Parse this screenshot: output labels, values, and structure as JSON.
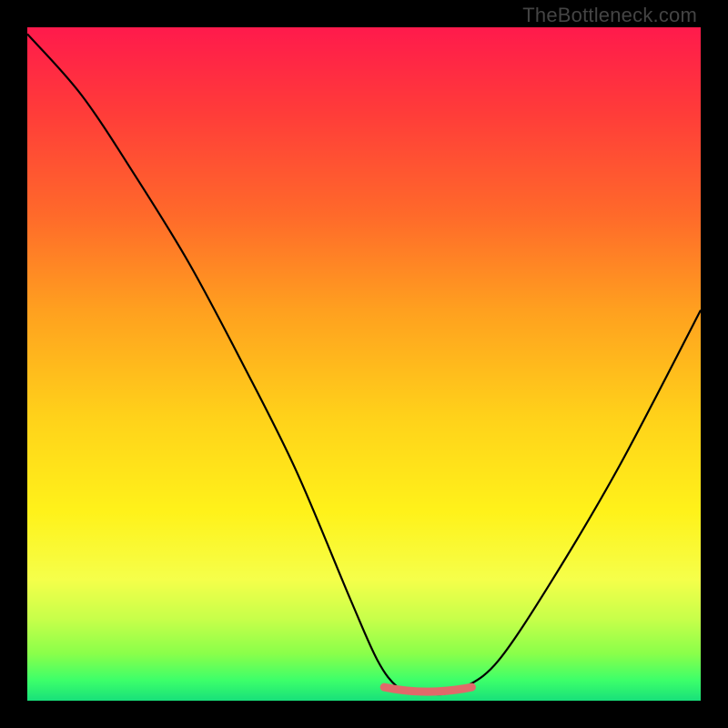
{
  "watermark": "TheBottleneck.com",
  "chart_data": {
    "type": "line",
    "title": "",
    "xlabel": "",
    "ylabel": "",
    "xlim": [
      0,
      100
    ],
    "ylim": [
      0,
      100
    ],
    "series": [
      {
        "name": "curve",
        "x": [
          0,
          8,
          16,
          24,
          32,
          40,
          48,
          52,
          55,
          58,
          60,
          62,
          65,
          70,
          78,
          88,
          100
        ],
        "y": [
          99,
          90,
          78,
          65,
          50,
          34,
          15,
          6,
          2,
          1,
          1,
          1,
          2,
          6,
          18,
          35,
          58
        ]
      }
    ],
    "highlight": {
      "color": "#e06a6a",
      "x_range": [
        53,
        66
      ],
      "y": 1.2
    },
    "background_gradient": [
      "#ff1a4c",
      "#ff3a3a",
      "#ff6a2a",
      "#ffa01f",
      "#ffd21a",
      "#fff21a",
      "#f5ff4a",
      "#c6ff4a",
      "#8aff4a",
      "#3cff6a",
      "#18e07a"
    ]
  }
}
